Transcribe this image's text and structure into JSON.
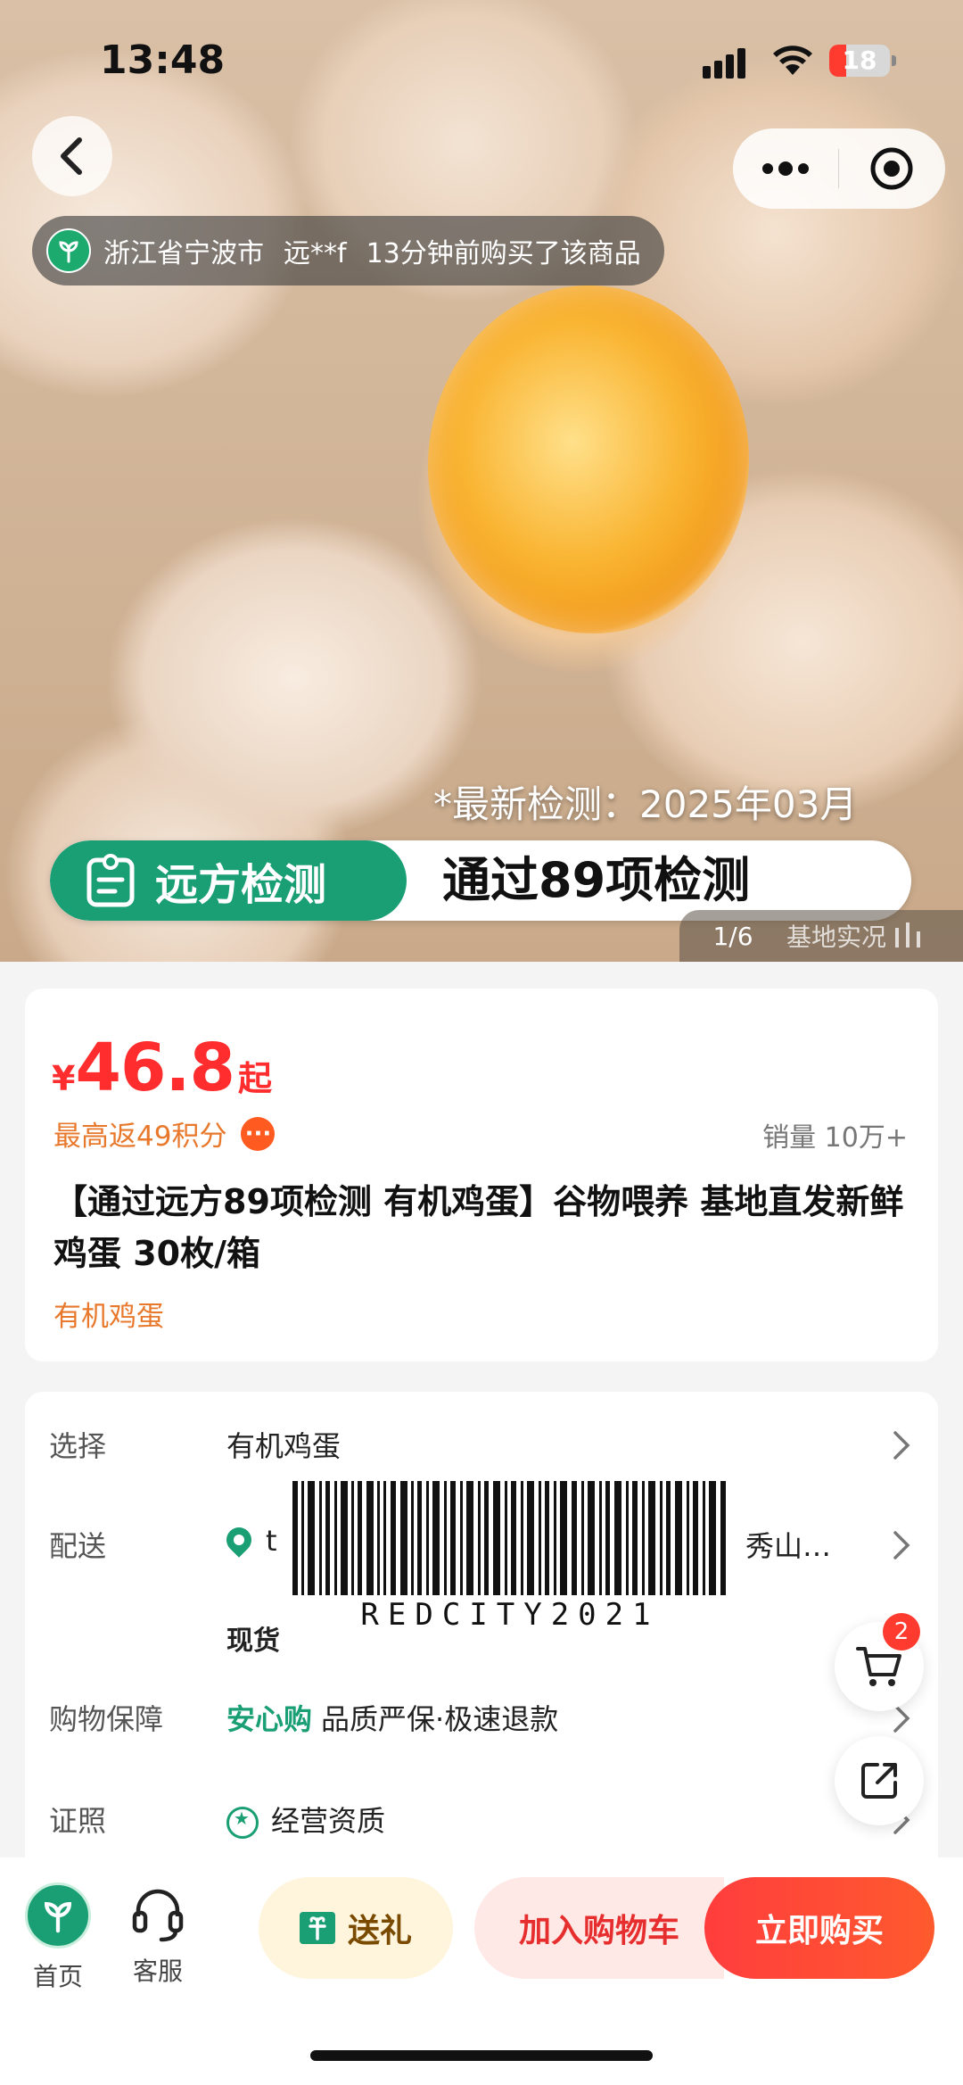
{
  "status_bar": {
    "time": "13:48",
    "battery": "18"
  },
  "hero": {
    "toast": {
      "location": "浙江省宁波市",
      "user": "远**f",
      "message": "13分钟前购买了该商品"
    },
    "test_date": "*最新检测：2025年03月",
    "banner_brand": "远方检测",
    "banner_message": "通过89项检测",
    "indicator": {
      "index": "1/6",
      "tag": "基地实况"
    }
  },
  "product": {
    "currency": "¥",
    "price": "46.8",
    "price_suffix": "起",
    "points": "最高返49积分",
    "sales": "销量 10万+",
    "title": "【通过远方89项检测 有机鸡蛋】谷物喂养 基地直发新鲜鸡蛋 30枚/箱",
    "subtitle": "有机鸡蛋"
  },
  "info": {
    "select": {
      "label": "选择",
      "value": "有机鸡蛋"
    },
    "delivery": {
      "label": "配送",
      "value_start": "t",
      "value_end": "秀山…",
      "stock": "现货"
    },
    "guarantee": {
      "label": "购物保障",
      "brand": "安心购",
      "value": "品质严保·极速退款"
    },
    "license": {
      "label": "证照",
      "value": "经营资质"
    }
  },
  "barcode": {
    "text": "REDCITY2021"
  },
  "cart_count": "2",
  "bottom_bar": {
    "home": "首页",
    "service": "客服",
    "gift": "送礼",
    "add_cart": "加入购物车",
    "buy_now": "立即购买"
  },
  "colors": {
    "accent_green": "#1a9e74",
    "price_red": "#ff2d2d",
    "points_orange": "#e8792c"
  }
}
